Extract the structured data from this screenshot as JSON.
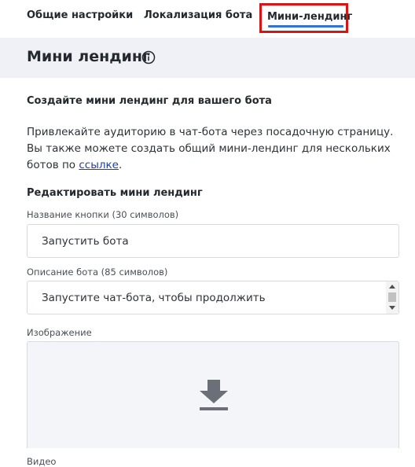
{
  "tabs": {
    "general": "Общие настройки",
    "localization": "Локализация бота",
    "mini_landing": "Мини-лендинг"
  },
  "header": {
    "title": "Мини лендинг",
    "info_icon": "info-icon"
  },
  "content": {
    "subtitle": "Создайте мини лендинг для вашего бота",
    "description_text": "Привлекайте аудиторию в чат-бота через посадочную страницу. Вы также можете создать общий мини-лендинг для нескольких ботов по ",
    "description_link": "ссылке",
    "description_end": ".",
    "edit_heading": "Редактировать мини лендинг"
  },
  "form": {
    "button_name_label": "Название кнопки (30 символов)",
    "button_name_value": "Запустить бота",
    "bot_desc_label": "Описание бота (85 символов)",
    "bot_desc_value": "Запустите чат-бота, чтобы продолжить",
    "image_label": "Изображение",
    "image_upload_icon": "download-icon",
    "video_label": "Видео"
  },
  "colors": {
    "active_tab_underline": "#3373c9",
    "highlight_border": "#d01818",
    "header_bg": "#eff1f6",
    "link": "#1f3f9e"
  }
}
